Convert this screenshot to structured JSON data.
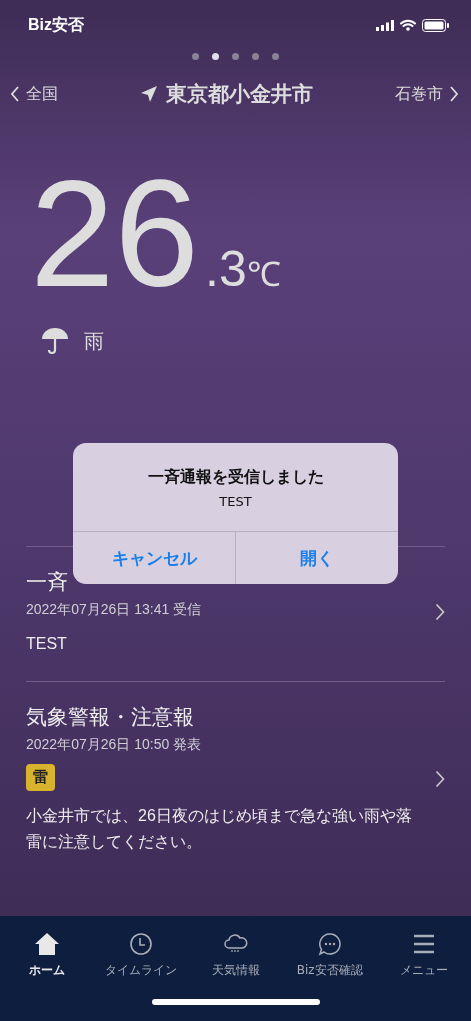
{
  "status_bar": {
    "app_label": "Biz安否"
  },
  "page_dots": [
    {
      "selected": false
    },
    {
      "selected": true
    },
    {
      "selected": false
    },
    {
      "selected": false
    },
    {
      "selected": false
    }
  ],
  "nav": {
    "prev": "全国",
    "current": "東京都小金井市",
    "next": "石巻市"
  },
  "weather": {
    "temp_whole": "26",
    "temp_decimal": ".3",
    "unit": "℃",
    "condition": "雨"
  },
  "alert": {
    "title": "一斉通報を受信しました",
    "message": "TEST",
    "buttons": [
      "キャンセル",
      "開く"
    ]
  },
  "sections": [
    {
      "title": "一斉",
      "date": "2022年07月26日 13:41 受信",
      "body": "TEST"
    },
    {
      "title": "気象警報・注意報",
      "date": "2022年07月26日 10:50 発表",
      "badge": "雷",
      "body": "小金井市では、26日夜のはじめ頃まで急な強い雨や落雷に注意してください。"
    }
  ],
  "tabs": [
    {
      "label": "ホーム",
      "selected": true
    },
    {
      "label": "タイムライン",
      "selected": false
    },
    {
      "label": "天気情報",
      "selected": false
    },
    {
      "label": "Biz安否確認",
      "selected": false
    },
    {
      "label": "メニュー",
      "selected": false
    }
  ]
}
